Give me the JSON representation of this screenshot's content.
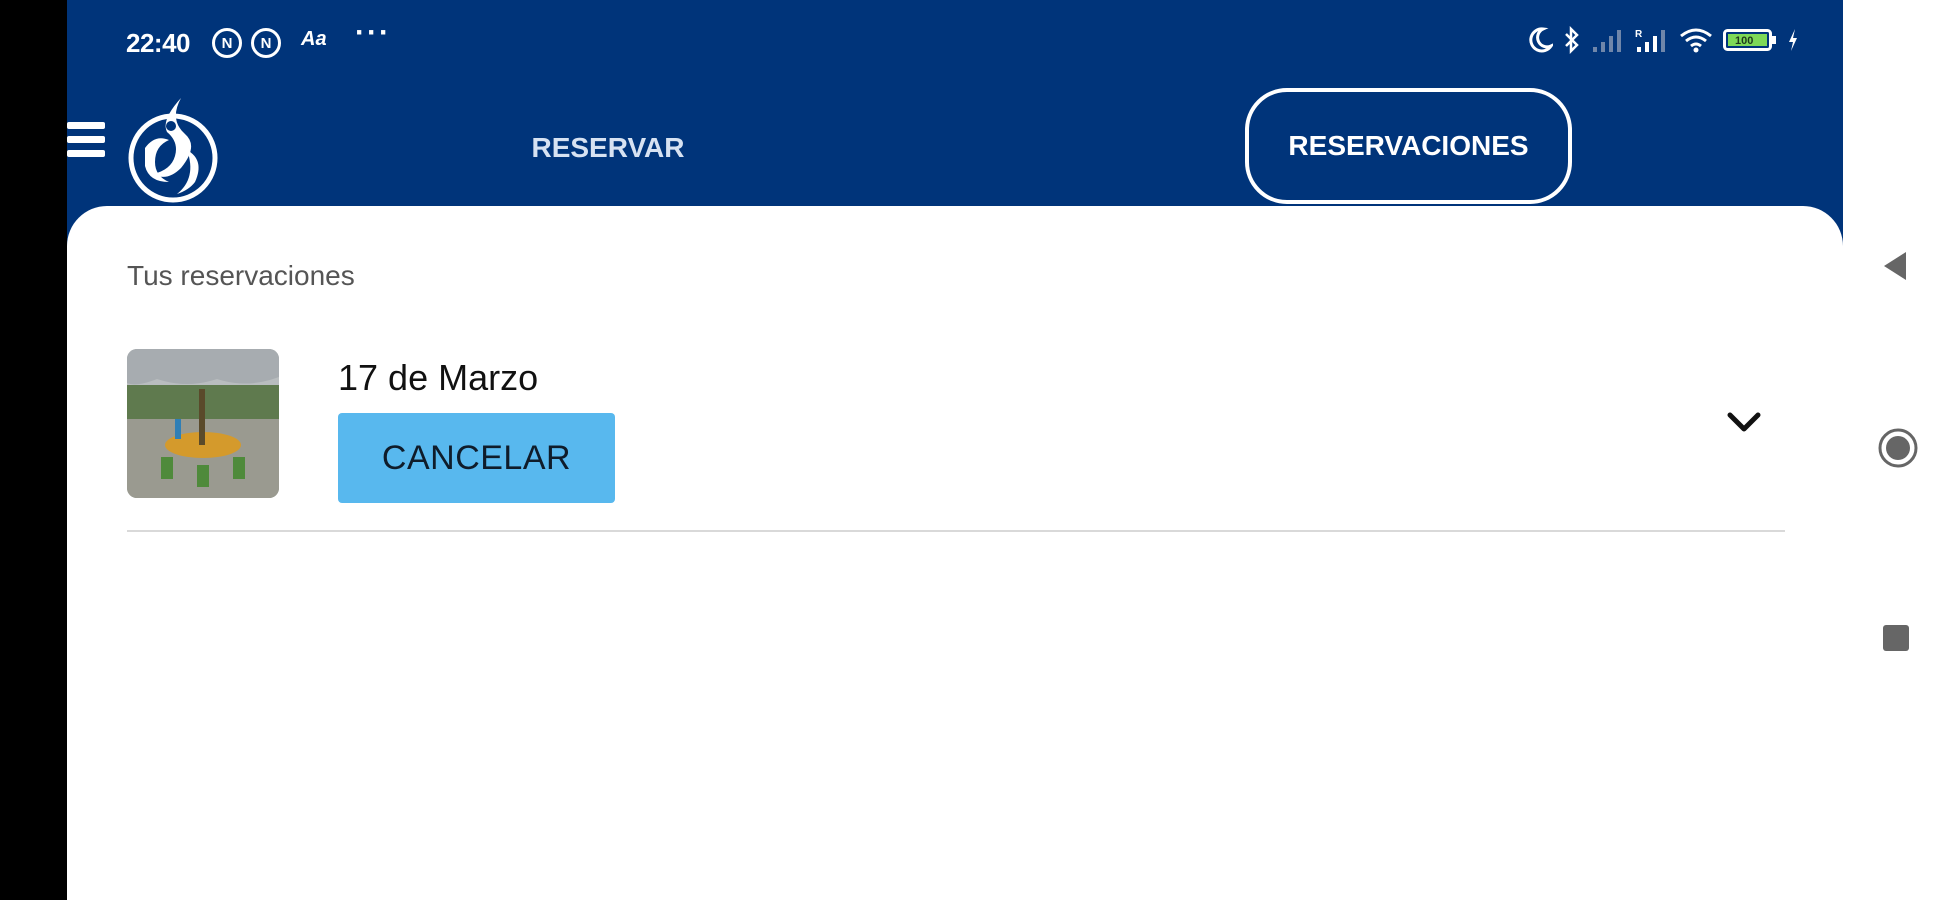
{
  "status_bar": {
    "time": "22:40",
    "notification_badges": [
      "N",
      "N"
    ],
    "accessibility_indicator": "Aa",
    "more_indicator": "···",
    "battery_level": "100",
    "icons": [
      "moon-icon",
      "bluetooth-icon",
      "signal-icon",
      "signal-icon",
      "wifi-icon",
      "battery-icon",
      "charging-icon"
    ]
  },
  "nav": {
    "tab_reservar": "RESERVAR",
    "tab_reservaciones": "RESERVACIONES",
    "active_tab": "RESERVACIONES"
  },
  "content": {
    "heading": "Tus reservaciones",
    "reservations": [
      {
        "date": "17 de Marzo",
        "cancel_label": "CANCELAR"
      }
    ]
  },
  "colors": {
    "brand_blue": "#00347a",
    "cancel_button": "#58b8ee",
    "card_background": "#ffffff"
  },
  "system_nav": {
    "icons": [
      "back-icon",
      "home-icon",
      "recents-icon"
    ]
  }
}
